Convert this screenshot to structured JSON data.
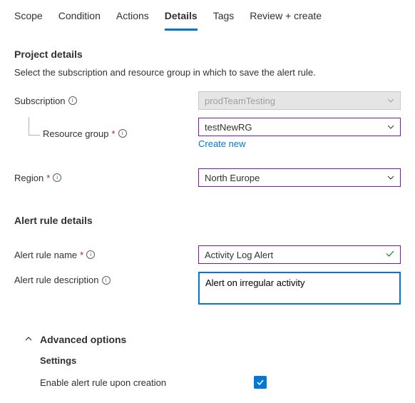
{
  "tabs": {
    "scope": "Scope",
    "condition": "Condition",
    "actions": "Actions",
    "details": "Details",
    "tags": "Tags",
    "review": "Review + create"
  },
  "project": {
    "title": "Project details",
    "hint": "Select the subscription and resource group in which to save the alert rule.",
    "subscription_label": "Subscription",
    "subscription_value": "prodTeamTesting",
    "resource_group_label": "Resource group",
    "resource_group_value": "testNewRG",
    "create_new": "Create new",
    "region_label": "Region",
    "region_value": "North Europe"
  },
  "alert": {
    "title": "Alert rule details",
    "name_label": "Alert rule name",
    "name_value": "Activity Log Alert",
    "desc_label": "Alert rule description",
    "desc_value": "Alert on irregular activity"
  },
  "advanced": {
    "title": "Advanced options",
    "settings": "Settings",
    "enable_label": "Enable alert rule upon creation"
  }
}
